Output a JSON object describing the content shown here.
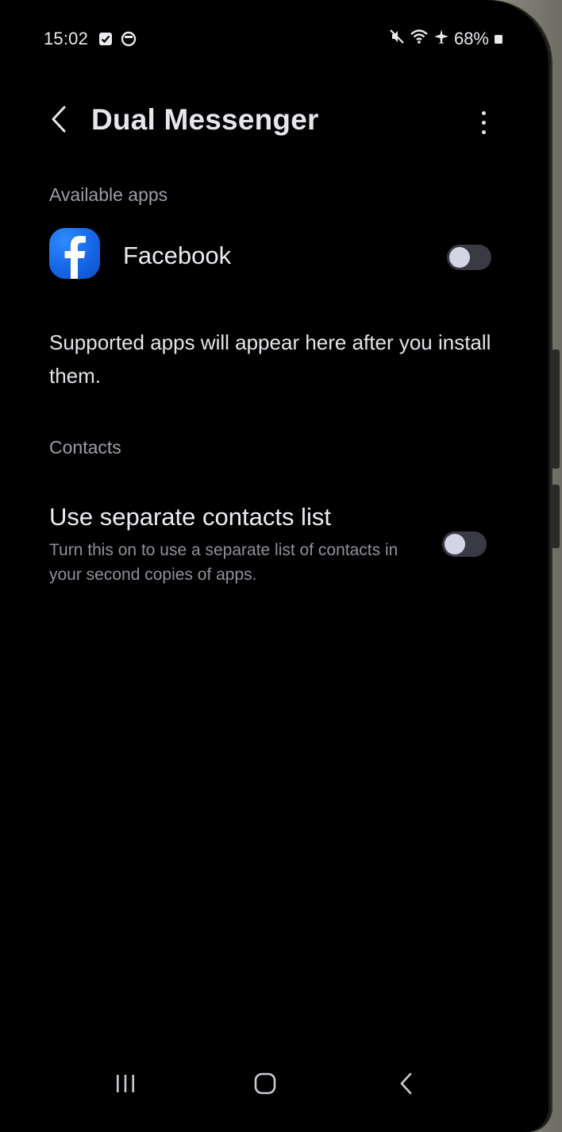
{
  "status_bar": {
    "time": "15:02",
    "left_icons": [
      "checkbox-notification-icon",
      "circle-notification-icon"
    ],
    "right_icons": [
      "mute-icon",
      "wifi-icon",
      "airplane-icon"
    ],
    "battery": "68%"
  },
  "app_bar": {
    "title": "Dual Messenger",
    "back_icon": "chevron-left-icon",
    "more_icon": "more-vertical-icon"
  },
  "available_apps": {
    "header": "Available apps",
    "items": [
      {
        "label": "Facebook",
        "icon": "facebook-icon",
        "enabled": false
      }
    ],
    "info": "Supported apps will appear here after you install them."
  },
  "contacts": {
    "header": "Contacts",
    "separate_list": {
      "title": "Use separate contacts list",
      "description": "Turn this on to use a separate list of contacts in your second copies of apps.",
      "enabled": false
    }
  },
  "nav_bar": {
    "recents_icon": "recents-icon",
    "home_icon": "home-icon",
    "back_icon": "back-icon"
  },
  "colors": {
    "background": "#000000",
    "text_primary": "#ececf2",
    "text_secondary": "#9d9da8",
    "toggle_track_off": "#3a3a44",
    "facebook_blue": "#1667e6"
  }
}
